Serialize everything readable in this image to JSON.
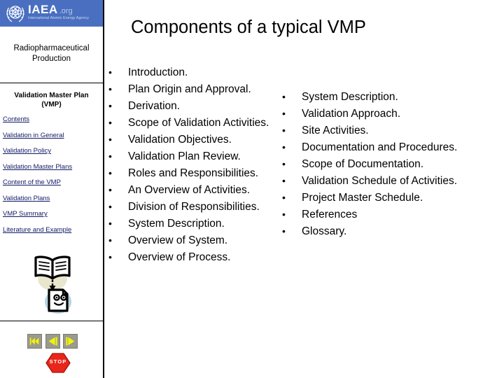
{
  "sidebar": {
    "banner": {
      "logo_icon": "iaea-atom-laurel-emblem",
      "wordmark": "IAEA",
      "wordmark_suffix": ".org",
      "subtitle": "International Atomic Energy Agency",
      "background_color": "#4a6fc0"
    },
    "subject_title": "Radiopharmaceutical Production",
    "section_heading_line1": "Validation Master Plan",
    "section_heading_line2": "(VMP)",
    "link_color": "#111b66",
    "links": [
      {
        "label": "Contents"
      },
      {
        "label": "Validation in General"
      },
      {
        "label": "Validation Policy"
      },
      {
        "label": "Validation Master Plans"
      },
      {
        "label": "Content of the VMP"
      },
      {
        "label": "Validation Plans"
      },
      {
        "label": "VMP Summary"
      },
      {
        "label": "Literature and Example"
      }
    ],
    "illustration": {
      "icon": "open-book-to-document-icon",
      "book_color": "#000000",
      "book_halo_color": "#e8e6cd",
      "document_halo_color": "#b7d3e0"
    },
    "player": {
      "buttons": [
        {
          "icon": "rewind-to-start-icon"
        },
        {
          "icon": "previous-slide-icon"
        },
        {
          "icon": "next-slide-icon"
        }
      ],
      "button_face_color": "#9a9a8e",
      "button_glyph_color": "#f2f20a"
    },
    "stop_button": {
      "label": "STOP",
      "icon": "stop-sign-icon",
      "color": "#e8261c"
    }
  },
  "main": {
    "title": "Components of a typical VMP",
    "columns": [
      {
        "name": "left",
        "bullet_glyph": "•",
        "items": [
          "Introduction.",
          "Plan Origin and Approval.",
          "Derivation.",
          "Scope of Validation Activities.",
          "Validation Objectives.",
          "Validation Plan Review.",
          "Roles and Responsibilities.",
          "An Overview of Activities.",
          "Division of Responsibilities.",
          "System Description.",
          "Overview of System.",
          "Overview of Process."
        ]
      },
      {
        "name": "right",
        "bullet_glyph": "•",
        "items": [
          "System Description.",
          "Validation Approach.",
          "Site Activities.",
          "Documentation and Procedures.",
          "Scope of Documentation.",
          "Validation Schedule of Activities.",
          "Project Master Schedule.",
          "References",
          "Glossary."
        ]
      }
    ]
  }
}
